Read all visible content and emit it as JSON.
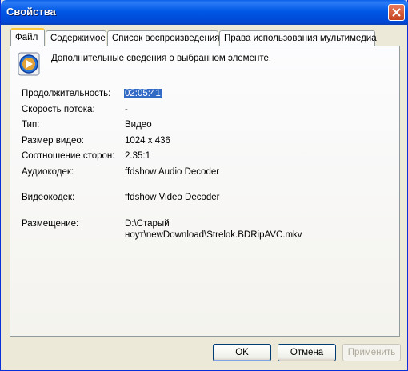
{
  "window": {
    "title": "Свойства"
  },
  "tabs": [
    {
      "label": "Файл"
    },
    {
      "label": "Содержимое"
    },
    {
      "label": "Список воспроизведения"
    },
    {
      "label": "Права использования мультимедиа"
    }
  ],
  "panel": {
    "description": "Дополнительные сведения о выбранном элементе.",
    "fields": {
      "duration": {
        "label": "Продолжительность:",
        "value": "02:05:41"
      },
      "bitrate": {
        "label": "Скорость потока:",
        "value": "-"
      },
      "type": {
        "label": "Тип:",
        "value": "Видео"
      },
      "video_size": {
        "label": "Размер видео:",
        "value": "1024 x 436"
      },
      "aspect": {
        "label": "Соотношение сторон:",
        "value": "2.35:1"
      },
      "audio_codec": {
        "label": "Аудиокодек:",
        "value": "ffdshow Audio Decoder"
      },
      "video_codec": {
        "label": "Видеокодек:",
        "value": "ffdshow Video Decoder"
      },
      "location": {
        "label": "Размещение:",
        "value_line1": "D:\\Старый",
        "value_line2": "ноут\\newDownload\\Strelok.BDRipAVC.mkv"
      }
    }
  },
  "buttons": {
    "ok": "OK",
    "cancel": "Отмена",
    "apply": "Применить"
  },
  "icons": {
    "close": "close-icon",
    "media": "media-player-icon"
  }
}
